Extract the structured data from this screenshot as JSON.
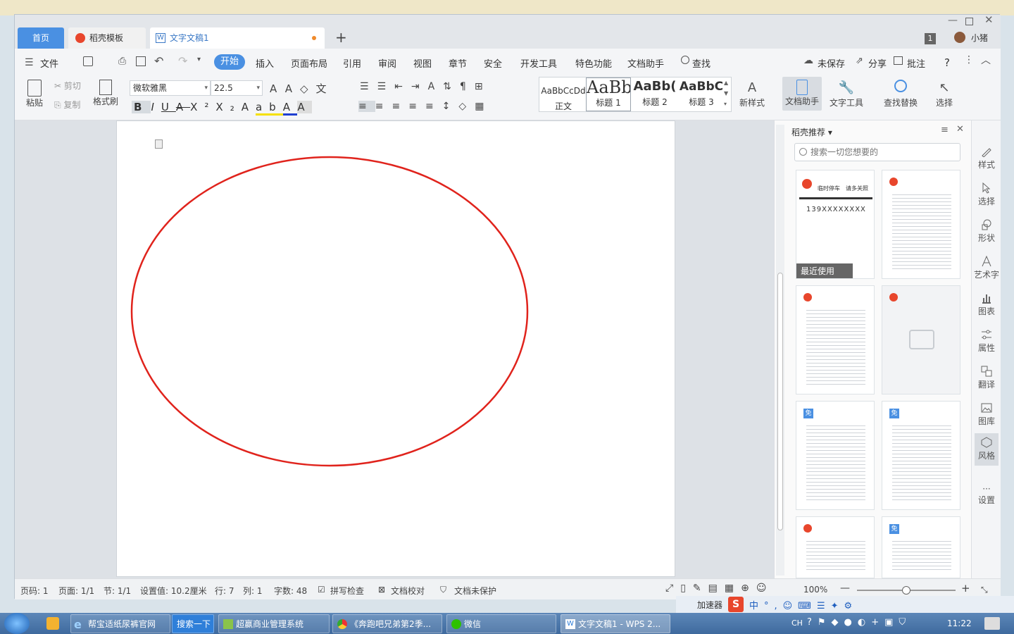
{
  "tabs": {
    "home": "首页",
    "template": "稻壳模板",
    "document": "文字文稿1"
  },
  "window": {
    "page_count_badge": "1",
    "user_name": "小猪"
  },
  "menu": {
    "file": "文件",
    "items": [
      "开始",
      "插入",
      "页面布局",
      "引用",
      "审阅",
      "视图",
      "章节",
      "安全",
      "开发工具",
      "特色功能",
      "文档助手"
    ],
    "search": "查找",
    "unsaved": "未保存",
    "share": "分享",
    "comment": "批注",
    "help": "?"
  },
  "ribbon": {
    "paste": "粘贴",
    "cut": "剪切",
    "copy": "复制",
    "format_painter": "格式刷",
    "font_name": "微软雅黑",
    "font_size": "22.5",
    "styles": [
      {
        "preview": "AaBbCcDd",
        "label": "正文"
      },
      {
        "preview": "AaBb",
        "label": "标题 1"
      },
      {
        "preview": "AaBb(",
        "label": "标题 2"
      },
      {
        "preview": "AaBbC",
        "label": "标题 3"
      }
    ],
    "new_style": "新样式",
    "doc_helper": "文档助手",
    "text_tools": "文字工具",
    "find_replace": "查找替换",
    "select": "选择"
  },
  "panel": {
    "title": "稻壳推荐",
    "search_placeholder": "搜索一切您想要的",
    "recent_label": "最近使用",
    "free_badge": "免",
    "card_texts": [
      "临时停车",
      "请多关照",
      "139XXXXXXXX"
    ]
  },
  "right_toolbar": [
    "样式",
    "选择",
    "形状",
    "艺术字",
    "图表",
    "属性",
    "翻译",
    "图库",
    "风格",
    "设置"
  ],
  "status": {
    "page": "页码: 1",
    "pages": "页面: 1/1",
    "section": "节: 1/1",
    "setting": "设置值: 10.2厘米",
    "row": "行: 7",
    "col": "列: 1",
    "words": "字数: 48",
    "spell": "拼写检查",
    "proof": "文档校对",
    "protect": "文档未保护",
    "zoom": "100%"
  },
  "langbar": {
    "accelerator": "加速器"
  },
  "taskbar": {
    "items": [
      "帮宝适纸尿裤官网",
      "搜索一下",
      "超赢商业管理系统",
      "《奔跑吧兄弟第2季...",
      "微信",
      "文字文稿1 - WPS 2..."
    ],
    "ime": "CH",
    "clock": "11:22"
  },
  "colors": {
    "accent": "#4a90e2",
    "ellipse": "#e0231c",
    "brand_red": "#e8462c"
  }
}
